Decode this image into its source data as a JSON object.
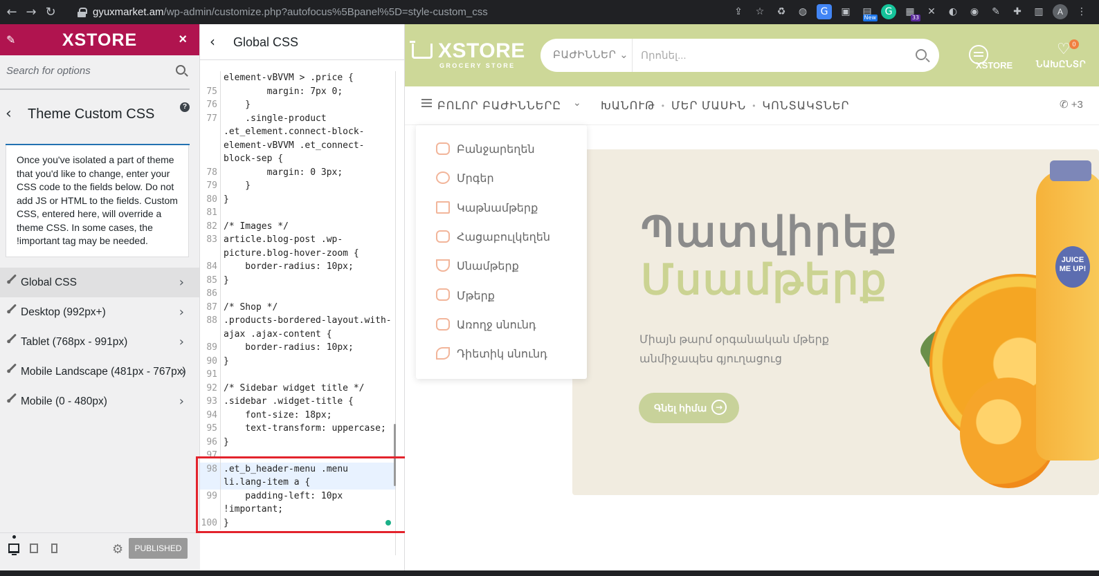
{
  "browser": {
    "url_host": "gyuxmarket.am",
    "url_path": "/wp-admin/customize.php?autofocus%5Bpanel%5D=style-custom_css",
    "ext_badge_new": "New",
    "ext_badge_count": "33",
    "profile_initial": "A"
  },
  "sidebar": {
    "brand": "XSTORE",
    "close": "×",
    "search_placeholder": "Search for options",
    "section_title": "Theme Custom CSS",
    "help": "?",
    "description": "Once you've isolated a part of theme that you'd like to change, enter your CSS code to the fields below. Do not add JS or HTML to the fields. Custom CSS, entered here, will override a theme CSS. In some cases, the !important tag may be needed.",
    "items": [
      {
        "label": "Global CSS",
        "active": true
      },
      {
        "label": "Desktop (992px+)",
        "active": false
      },
      {
        "label": "Tablet (768px - 991px)",
        "active": false
      },
      {
        "label": "Mobile Landscape (481px - 767px)",
        "active": false
      },
      {
        "label": "Mobile (0 - 480px)",
        "active": false
      }
    ],
    "publish_label": "PUBLISHED"
  },
  "code_panel": {
    "title": "Global CSS",
    "lines": [
      {
        "n": "",
        "t": "element-vBVVM > .price {",
        "k": ""
      },
      {
        "n": "75",
        "t": "        margin: 7px 0;",
        "k": ""
      },
      {
        "n": "76",
        "t": "    }",
        "k": ""
      },
      {
        "n": "77",
        "t": "    .single-product",
        "k": ""
      },
      {
        "n": "",
        "t": ".et_element.connect-block-",
        "k": ""
      },
      {
        "n": "",
        "t": "element-vBVVM .et_connect-",
        "k": ""
      },
      {
        "n": "",
        "t": "block-sep {",
        "k": ""
      },
      {
        "n": "78",
        "t": "        margin: 0 3px;",
        "k": ""
      },
      {
        "n": "79",
        "t": "    }",
        "k": ""
      },
      {
        "n": "80",
        "t": "}",
        "k": ""
      },
      {
        "n": "81",
        "t": "",
        "k": ""
      },
      {
        "n": "82",
        "t": "/* Images */",
        "k": "cm"
      },
      {
        "n": "83",
        "t": "article.blog-post .wp-",
        "k": ""
      },
      {
        "n": "",
        "t": "picture.blog-hover-zoom {",
        "k": ""
      },
      {
        "n": "84",
        "t": "    border-radius: 10px;",
        "k": ""
      },
      {
        "n": "85",
        "t": "}",
        "k": ""
      },
      {
        "n": "86",
        "t": "",
        "k": ""
      },
      {
        "n": "87",
        "t": "/* Shop */",
        "k": "cm"
      },
      {
        "n": "88",
        "t": ".products-bordered-layout.with-",
        "k": ""
      },
      {
        "n": "",
        "t": "ajax .ajax-content {",
        "k": ""
      },
      {
        "n": "89",
        "t": "    border-radius: 10px;",
        "k": ""
      },
      {
        "n": "90",
        "t": "}",
        "k": ""
      },
      {
        "n": "91",
        "t": "",
        "k": ""
      },
      {
        "n": "92",
        "t": "/* Sidebar widget title */",
        "k": "cm"
      },
      {
        "n": "93",
        "t": ".sidebar .widget-title {",
        "k": ""
      },
      {
        "n": "94",
        "t": "    font-size: 18px;",
        "k": ""
      },
      {
        "n": "95",
        "t": "    text-transform: uppercase;",
        "k": ""
      },
      {
        "n": "96",
        "t": "}",
        "k": ""
      },
      {
        "n": "97",
        "t": "",
        "k": ""
      },
      {
        "n": "98",
        "t": ".et_b_header-menu .menu",
        "k": "hl"
      },
      {
        "n": "",
        "t": "li.lang-item a {",
        "k": "hl"
      },
      {
        "n": "99",
        "t": "    padding-left: 10px",
        "k": ""
      },
      {
        "n": "",
        "t": "!important;",
        "k": "im"
      },
      {
        "n": "100",
        "t": "}",
        "k": ""
      }
    ]
  },
  "site": {
    "logo_name": "XSTORE",
    "logo_sub": "GROCERY STORE",
    "search_category": "ԲԱԺԻՆՆԵՐ",
    "search_placeholder": "Որոնել...",
    "account_label": "XSTORE",
    "wishlist_label": "ՆԱԽԸՆՏՐ",
    "wishlist_count": "0",
    "nav_all_categories": "ԲՈԼՈՐ ԲԱԺԻՆՆԵՐԸ",
    "nav_links": [
      "ԽԱՆՈՒԹ",
      "ՄԵՐ ՄԱՍԻՆ",
      "ԿՈՆՏԱԿՏՆԵՐ"
    ],
    "nav_phone": "+3",
    "categories": [
      "Բանջարեղեն",
      "Մրգեր",
      "Կաթնամթերք",
      "Հացաբուլկեղեն",
      "Սնամթերք",
      "Մթերք",
      "Առողջ սնունդ",
      "Դիետիկ սնունդ"
    ],
    "hero_title_1": "Պատվիրեք",
    "hero_title_2": "Մսամթերք",
    "hero_desc": "Միայն թարմ օրգանական մթերք անմիջապես գյուղացուց",
    "hero_cta": "Գնել հիմա",
    "bottle_label": "JUICE ME UP!"
  }
}
